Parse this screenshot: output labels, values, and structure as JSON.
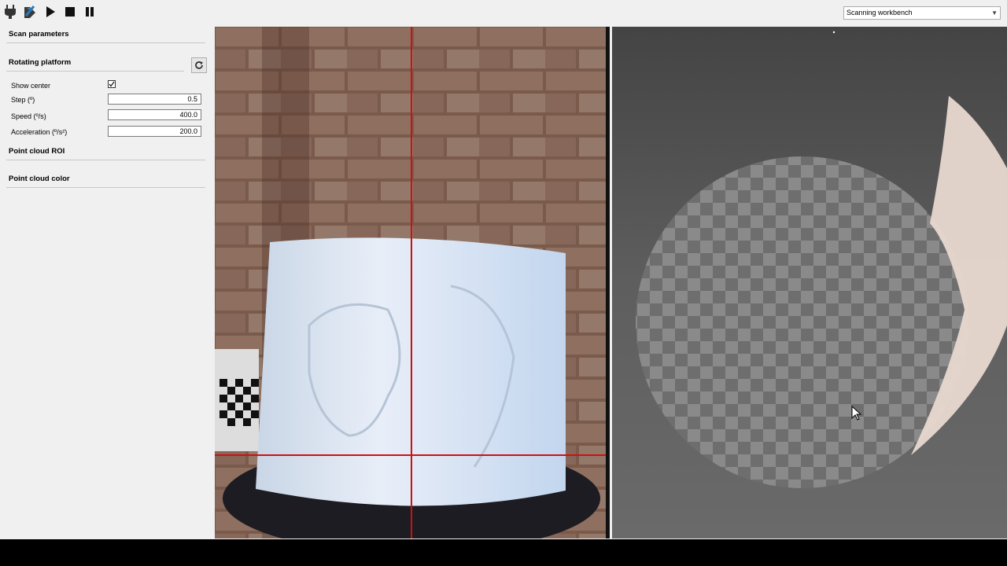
{
  "toolbar": {
    "buttons": [
      {
        "name": "connect",
        "icon": "plug-icon"
      },
      {
        "name": "calibrate",
        "icon": "calibration-icon"
      },
      {
        "name": "play",
        "icon": "play-icon"
      },
      {
        "name": "stop",
        "icon": "stop-icon"
      },
      {
        "name": "pause",
        "icon": "pause-icon"
      }
    ],
    "workbench_selected": "Scanning workbench"
  },
  "panel": {
    "scan_parameters": "Scan parameters",
    "rotating_platform": "Rotating platform",
    "show_center_label": "Show center",
    "show_center_checked": true,
    "step_label": "Step (º)",
    "step_value": "0.5",
    "speed_label": "Speed (º/s)",
    "speed_value": "400.0",
    "acceleration_label": "Acceleration (º/s²)",
    "acceleration_value": "200.0",
    "point_cloud_roi": "Point cloud ROI",
    "point_cloud_color": "Point cloud color"
  },
  "colors": {
    "crosshair": "#d01010",
    "accent_blue": "#2a7ab8",
    "panel_bg": "#f0f0f0"
  }
}
